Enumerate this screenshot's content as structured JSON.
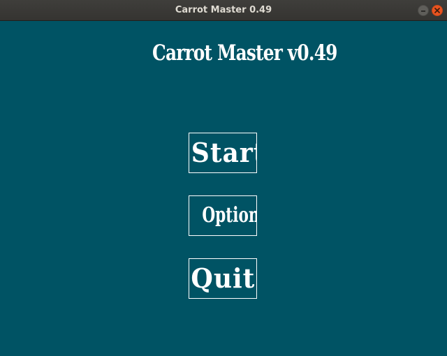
{
  "window": {
    "title": "Carrot Master 0.49",
    "controls": {
      "minimize_icon": "minimize-icon",
      "close_icon": "close-icon"
    }
  },
  "game": {
    "title": "Carrot Master v0.49",
    "background_color": "#005364",
    "menu": {
      "start_label": "Start",
      "options_label": "Options",
      "quit_label": "Quit"
    }
  },
  "colors": {
    "close_button": "#e95420",
    "text": "#ffffff"
  }
}
